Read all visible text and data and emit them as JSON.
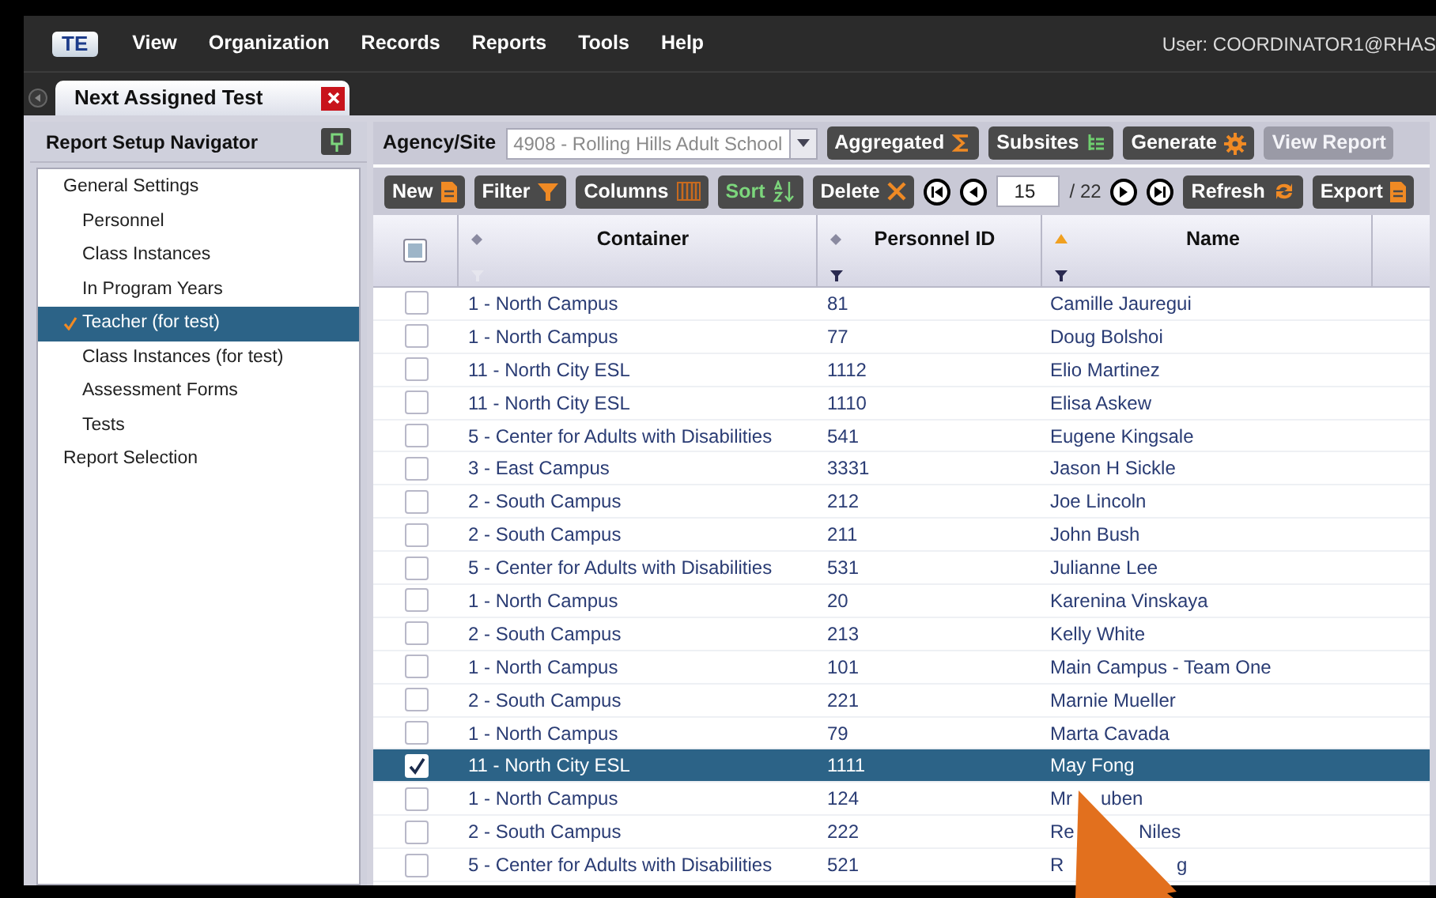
{
  "menu": {
    "logo": "TE",
    "items": [
      "View",
      "Organization",
      "Records",
      "Reports",
      "Tools",
      "Help"
    ],
    "user": "User: COORDINATOR1@RHAS"
  },
  "tab": {
    "title": "Next Assigned Test"
  },
  "navigator": {
    "title": "Report Setup Navigator",
    "items": [
      {
        "label": "General Settings",
        "selected": false,
        "children": [
          {
            "label": "Personnel",
            "selected": false
          },
          {
            "label": "Class Instances",
            "selected": false
          },
          {
            "label": "In Program Years",
            "selected": false
          },
          {
            "label": "Teacher (for test)",
            "selected": true
          },
          {
            "label": "Class Instances (for test)",
            "selected": false
          },
          {
            "label": "Assessment Forms",
            "selected": false
          },
          {
            "label": "Tests",
            "selected": false
          }
        ]
      },
      {
        "label": "Report Selection",
        "selected": false
      }
    ]
  },
  "toolbar": {
    "agency_label": "Agency/Site",
    "agency_value": "4908 - Rolling Hills Adult School",
    "buttons": [
      {
        "label": "Aggregated",
        "disabled": false
      },
      {
        "label": "Subsites",
        "disabled": false
      },
      {
        "label": "Generate",
        "disabled": false
      },
      {
        "label": "View Report",
        "disabled": true
      }
    ]
  },
  "grid_toolbar": {
    "buttons": [
      {
        "label": "New",
        "active": false
      },
      {
        "label": "Filter",
        "active": false
      },
      {
        "label": "Columns",
        "active": false
      },
      {
        "label": "Sort",
        "active": true
      },
      {
        "label": "Delete",
        "active": false
      }
    ],
    "page": "15",
    "page_total": "/ 22",
    "buttons_right": [
      {
        "label": "Refresh",
        "active": false
      },
      {
        "label": "Export",
        "active": false
      }
    ]
  },
  "table": {
    "columns": [
      {
        "label": "Container",
        "sorted": false,
        "filter": false
      },
      {
        "label": "Personnel ID",
        "sorted": false,
        "filter": true
      },
      {
        "label": "Name",
        "sorted": true,
        "filter": true
      }
    ],
    "header_checkbox": {
      "partial": true
    },
    "rows": [
      {
        "selected": false,
        "container": "1 - North Campus",
        "personnel_id": "81",
        "name": [
          "Camille Jauregui"
        ]
      },
      {
        "selected": false,
        "container": "1 - North Campus",
        "personnel_id": "77",
        "name": [
          "Doug Bolshoi"
        ]
      },
      {
        "selected": false,
        "container": "11 - North City ESL",
        "personnel_id": "1112",
        "name": [
          "Elio Martinez"
        ]
      },
      {
        "selected": false,
        "container": "11 - North City ESL",
        "personnel_id": "1110",
        "name": [
          "Elisa Askew"
        ]
      },
      {
        "selected": false,
        "container": "5 - Center for Adults with Disabilities",
        "personnel_id": "541",
        "name": [
          "Eugene Kingsale"
        ]
      },
      {
        "selected": false,
        "container": "3 - East Campus",
        "personnel_id": "3331",
        "name": [
          "Jason H Sickle"
        ]
      },
      {
        "selected": false,
        "container": "2 - South Campus",
        "personnel_id": "212",
        "name": [
          "Joe Lincoln"
        ]
      },
      {
        "selected": false,
        "container": "2 - South Campus",
        "personnel_id": "211",
        "name": [
          "John Bush"
        ]
      },
      {
        "selected": false,
        "container": "5 - Center for Adults with Disabilities",
        "personnel_id": "531",
        "name": [
          "Julianne Lee"
        ]
      },
      {
        "selected": false,
        "container": "1 - North Campus",
        "personnel_id": "20",
        "name": [
          "Karenina Vinskaya"
        ]
      },
      {
        "selected": false,
        "container": "2 - South Campus",
        "personnel_id": "213",
        "name": [
          "Kelly White"
        ]
      },
      {
        "selected": false,
        "container": "1 - North Campus",
        "personnel_id": "101",
        "name": [
          "Main Campus - Team One"
        ]
      },
      {
        "selected": false,
        "container": "2 - South Campus",
        "personnel_id": "221",
        "name": [
          "Marnie Mueller"
        ]
      },
      {
        "selected": false,
        "container": "1 - North Campus",
        "personnel_id": "79",
        "name": [
          "Marta Cavada"
        ]
      },
      {
        "selected": true,
        "container": "11 - North City ESL",
        "personnel_id": "1111",
        "name": [
          "May Fong"
        ]
      },
      {
        "selected": false,
        "container": "1 - North Campus",
        "personnel_id": "124",
        "name": [
          "Mr",
          "uben"
        ]
      },
      {
        "selected": false,
        "container": "2 - South Campus",
        "personnel_id": "222",
        "name": [
          "Re",
          "Niles"
        ]
      },
      {
        "selected": false,
        "container": "5 - Center for Adults with Disabilities",
        "personnel_id": "521",
        "name": [
          "R",
          "g"
        ]
      }
    ]
  }
}
